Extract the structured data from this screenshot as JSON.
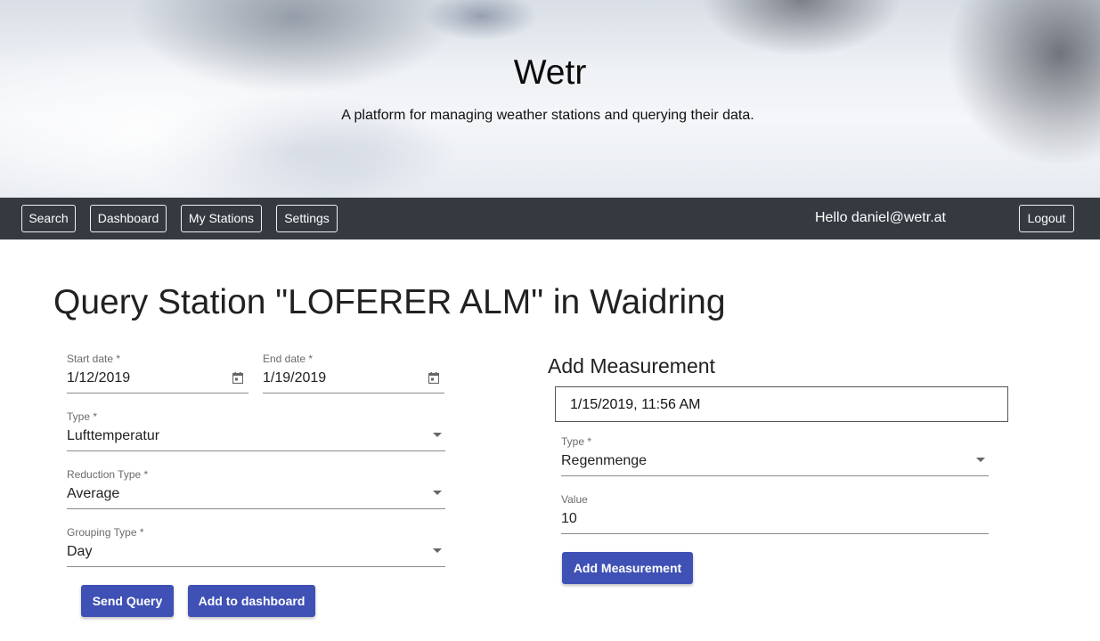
{
  "header": {
    "title": "Wetr",
    "subtitle": "A platform for managing weather stations and querying their data."
  },
  "nav": {
    "items": [
      "Search",
      "Dashboard",
      "My Stations",
      "Settings"
    ],
    "greeting": "Hello daniel@wetr.at",
    "logout_label": "Logout"
  },
  "page": {
    "title": "Query Station \"LOFERER ALM\" in Waidring"
  },
  "query_form": {
    "start_date": {
      "label": "Start date *",
      "value": "1/12/2019",
      "icon": "calendar-icon"
    },
    "end_date": {
      "label": "End date *",
      "value": "1/19/2019",
      "icon": "calendar-icon"
    },
    "type": {
      "label": "Type *",
      "value": "Lufttemperatur"
    },
    "reduction_type": {
      "label": "Reduction Type *",
      "value": "Average"
    },
    "grouping_type": {
      "label": "Grouping Type *",
      "value": "Day"
    },
    "send_query_label": "Send Query",
    "add_dashboard_label": "Add to dashboard"
  },
  "measurement_form": {
    "title": "Add Measurement",
    "datetime": "1/15/2019, 11:56 AM",
    "type": {
      "label": "Type *",
      "value": "Regenmenge"
    },
    "value": {
      "label": "Value",
      "value": "10"
    },
    "submit_label": "Add Measurement"
  },
  "colors": {
    "navbar": "#343a40",
    "primary_button": "#3f51b5"
  }
}
